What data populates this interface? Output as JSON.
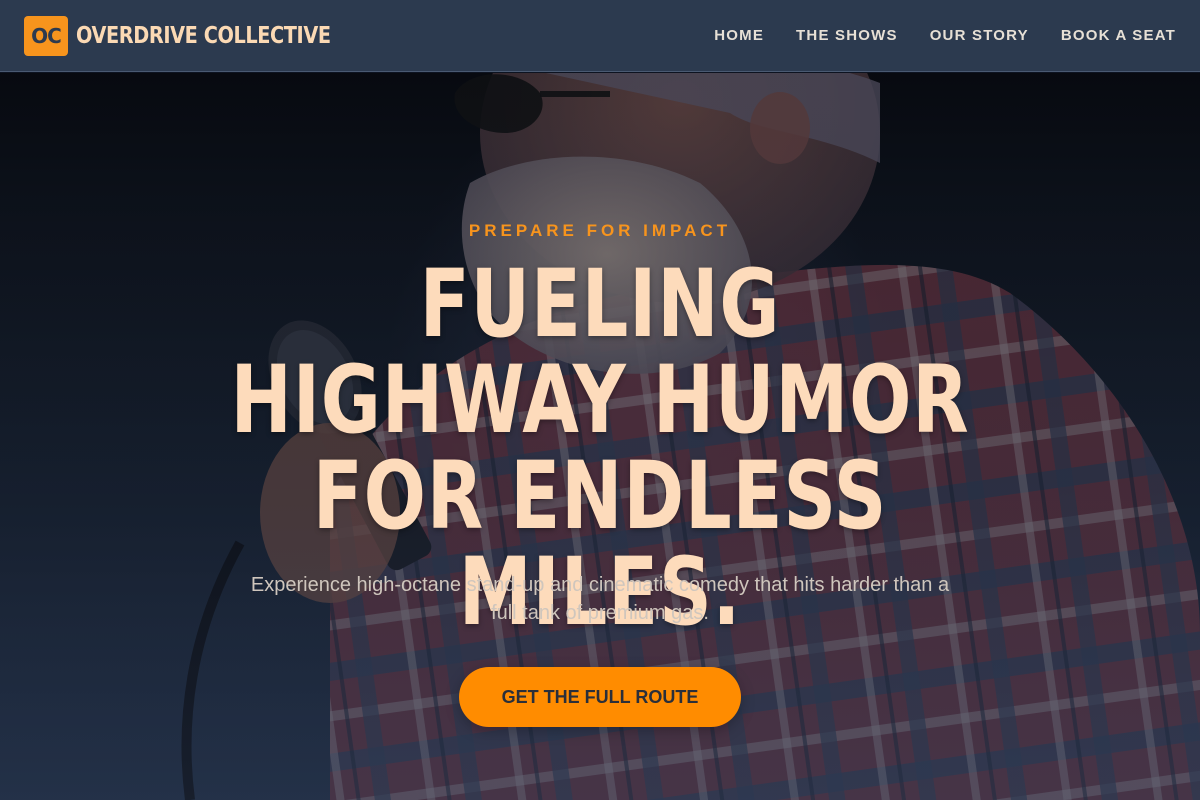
{
  "header": {
    "logo_initials": "OC",
    "brand_name": "OVERDRIVE COLLECTIVE",
    "nav": [
      {
        "label": "HOME"
      },
      {
        "label": "THE SHOWS"
      },
      {
        "label": "OUR STORY"
      },
      {
        "label": "BOOK A SEAT"
      }
    ]
  },
  "hero": {
    "eyebrow": "PREPARE FOR IMPACT",
    "headline": "FUELING HIGHWAY HUMOR FOR ENDLESS MILES.",
    "subtitle": "Experience high-octane stand-up and cinematic comedy that hits harder than a full tank of premium gas.",
    "cta_label": "GET THE FULL ROUTE",
    "background_image": "comedian-with-microphone-photo"
  },
  "colors": {
    "header_bg": "#2c3a4f",
    "accent": "#f7941d",
    "cta": "#ff8c00",
    "headline": "#fddbbb"
  }
}
